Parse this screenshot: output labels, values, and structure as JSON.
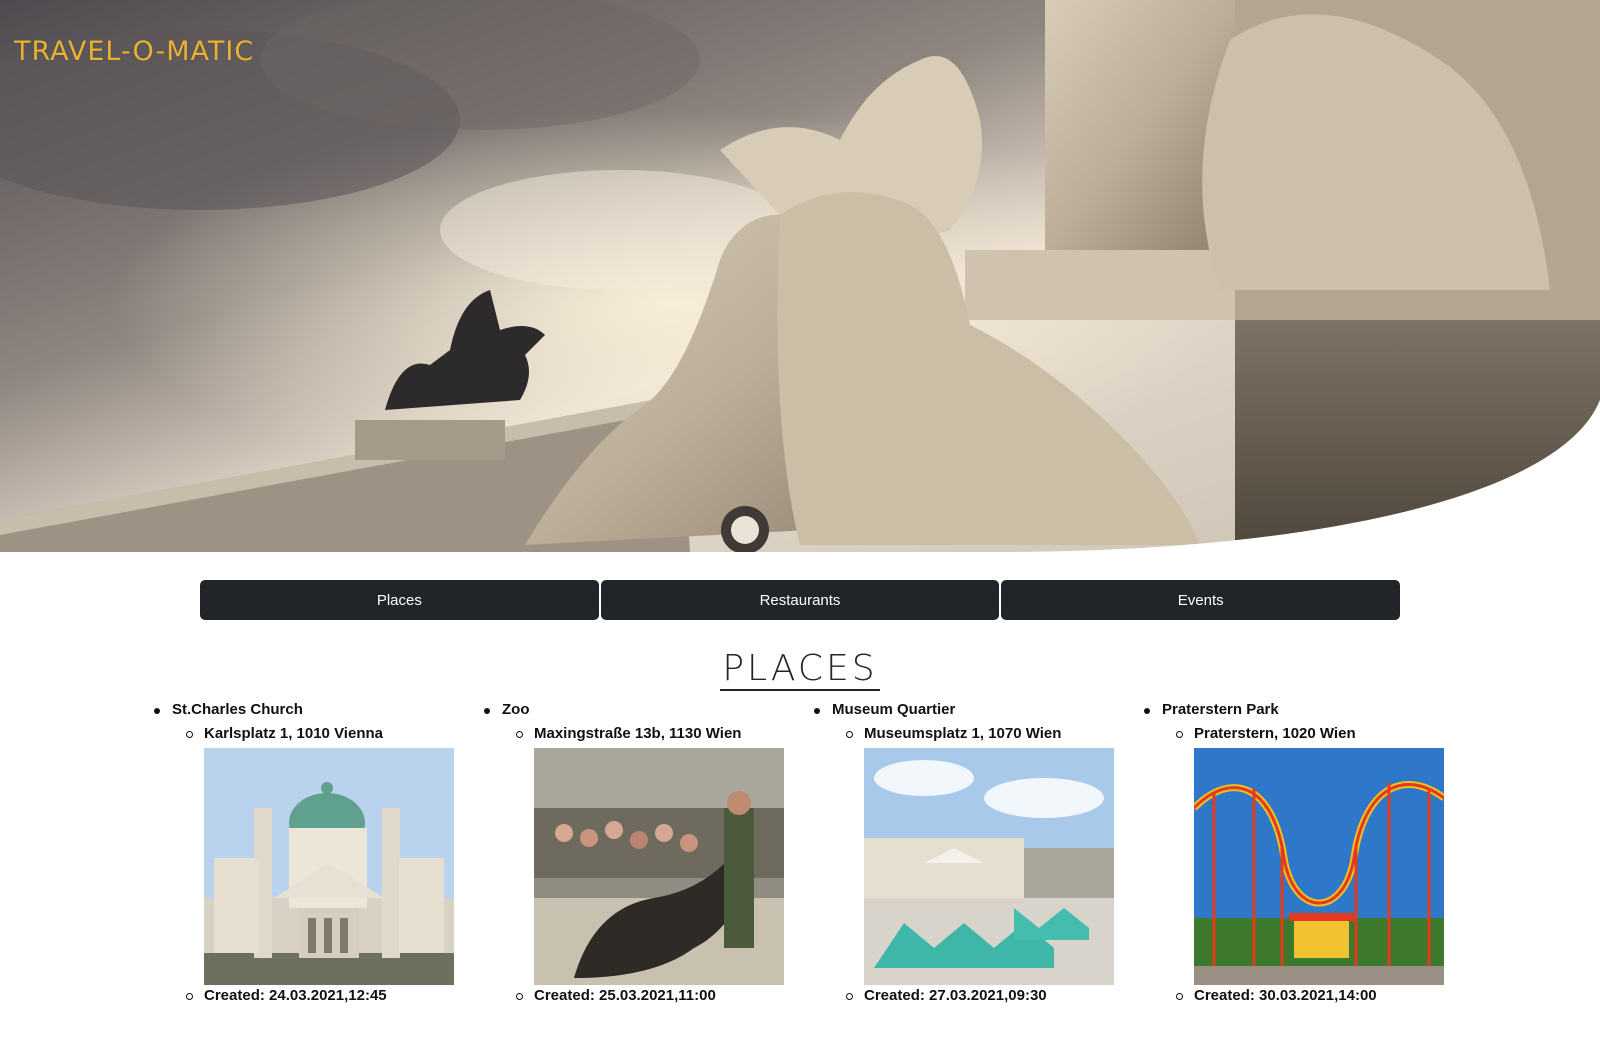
{
  "brand": {
    "logo_text": "TRAVEL-O-MATIC",
    "logo_color": "#e9b233"
  },
  "hero": {
    "image_name": "vienna-parliament-statue-photo"
  },
  "nav": {
    "items": [
      {
        "label": "Places"
      },
      {
        "label": "Restaurants"
      },
      {
        "label": "Events"
      }
    ],
    "button_color": "#212529"
  },
  "section": {
    "title": "PLACES"
  },
  "places": [
    {
      "name": "St.Charles Church",
      "address": "Karlsplatz 1, 1010 Vienna",
      "image_name": "st-charles-church-photo",
      "created": "Created: 24.03.2021,12:45"
    },
    {
      "name": "Zoo",
      "address": "Maxingstraße 13b, 1130 Wien",
      "image_name": "zoo-sea-lions-photo",
      "created": "Created: 25.03.2021,11:00"
    },
    {
      "name": "Museum Quartier",
      "address": "Museumsplatz 1, 1070 Wien",
      "image_name": "museum-quartier-photo",
      "created": "Created: 27.03.2021,09:30"
    },
    {
      "name": "Praterstern Park",
      "address": "Praterstern, 1020 Wien",
      "image_name": "prater-rollercoaster-photo",
      "created": "Created: 30.03.2021,14:00"
    }
  ]
}
